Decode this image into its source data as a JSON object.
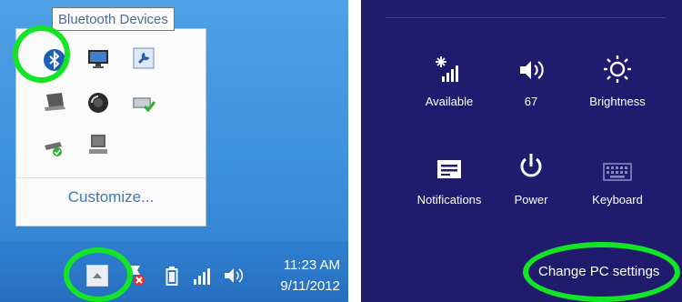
{
  "tray": {
    "tooltip": "Bluetooth Devices",
    "customize_label": "Customize...",
    "clock_time": "11:23 AM",
    "clock_date": "9/11/2012",
    "icons": [
      "bluetooth-icon",
      "monitor-icon",
      "tool-icon",
      "laptop-icon",
      "speaker-icon",
      "network-check-icon",
      "usb-drive-icon",
      "computer-icon"
    ]
  },
  "settings_charm": {
    "tiles": [
      {
        "label": "Available",
        "icon": "wifi-signal-icon"
      },
      {
        "label": "67",
        "icon": "volume-icon"
      },
      {
        "label": "Brightness",
        "icon": "brightness-icon"
      },
      {
        "label": "Notifications",
        "icon": "notifications-icon"
      },
      {
        "label": "Power",
        "icon": "power-icon"
      },
      {
        "label": "Keyboard",
        "icon": "keyboard-icon"
      }
    ],
    "change_pc_settings": "Change PC settings"
  },
  "colors": {
    "highlight_ring": "#13e526",
    "charm_background": "#211b6e",
    "desktop_blue": "#3d90dc"
  }
}
